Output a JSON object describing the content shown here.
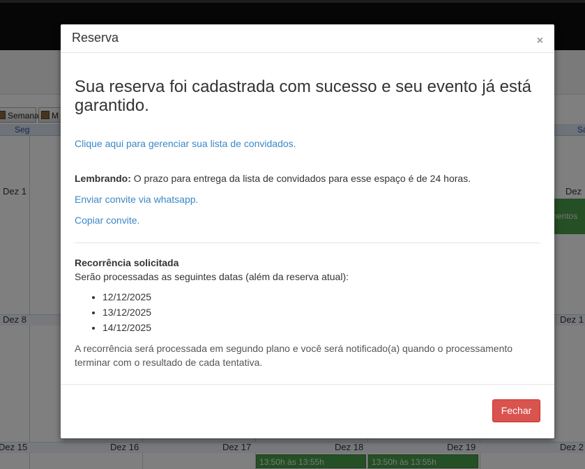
{
  "background": {
    "toolbar": {
      "week_label": "Semana",
      "month_label_partial": "M"
    },
    "day_headers": {
      "mon": "Seg",
      "sat": "Sá"
    },
    "day_numbers": {
      "dez1": "Dez 1",
      "dez6": "Dez",
      "dez8": "Dez 8",
      "dez13": "Dez 1",
      "dez15": "Dez 15",
      "dez16": "Dez 16",
      "dez17": "Dez 17",
      "dez18": "Dez 18",
      "dez19": "Dez 19",
      "dez20": "Dez 2"
    },
    "events": {
      "e1": "13:50h às 13:55h",
      "e2": "13:50h às 13:55h",
      "side": "mentos"
    }
  },
  "modal": {
    "title": "Reserva",
    "close_symbol": "×",
    "headline": "Sua reserva foi cadastrada com sucesso e seu evento já está garantido.",
    "manage_link": "Clique aqui para gerenciar sua lista de convidados.",
    "reminder_label": "Lembrando:",
    "reminder_text": " O prazo para entrega da lista de convidados para esse espaço é de 24 horas.",
    "whatsapp_link": "Enviar convite via whatsapp.",
    "copy_link": "Copiar convite.",
    "recurrence_title": "Recorrência solicitada",
    "recurrence_subtitle": "Serão processadas as seguintes datas (além da reserva atual):",
    "dates": [
      "12/12/2025",
      "13/12/2025",
      "14/12/2025"
    ],
    "note": "A recorrência será processada em segundo plano e você será notificado(a) quando o processamento terminar com o resultado de cada tentativa.",
    "close_button": "Fechar"
  }
}
